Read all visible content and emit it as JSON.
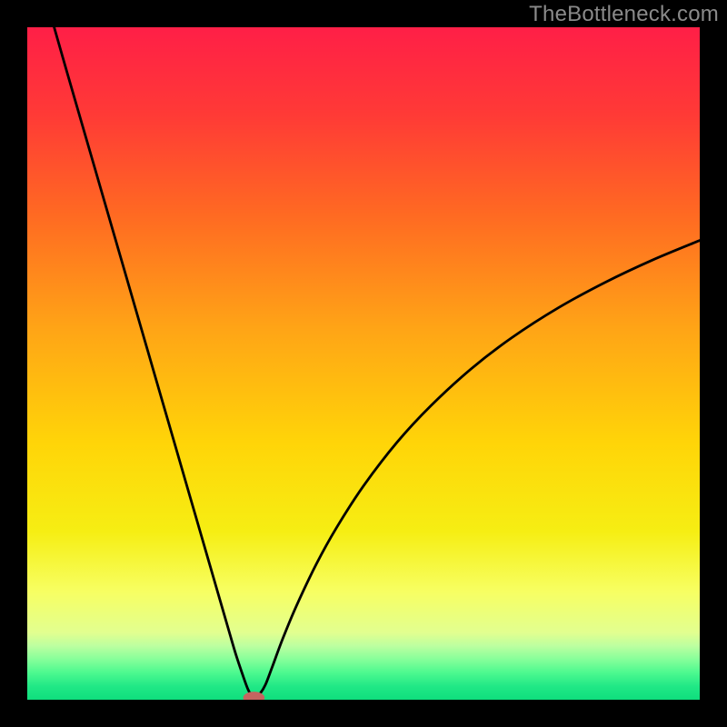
{
  "watermark": "TheBottleneck.com",
  "chart_data": {
    "type": "line",
    "title": "",
    "xlabel": "",
    "ylabel": "",
    "xlim": [
      0,
      100
    ],
    "ylim": [
      0,
      100
    ],
    "background_gradient_stops": [
      {
        "offset": 0.0,
        "color": "#ff1f47"
      },
      {
        "offset": 0.13,
        "color": "#ff3a36"
      },
      {
        "offset": 0.28,
        "color": "#ff6a22"
      },
      {
        "offset": 0.45,
        "color": "#ffa516"
      },
      {
        "offset": 0.62,
        "color": "#ffd508"
      },
      {
        "offset": 0.75,
        "color": "#f6ee13"
      },
      {
        "offset": 0.84,
        "color": "#f7ff63"
      },
      {
        "offset": 0.9,
        "color": "#e2ff8f"
      },
      {
        "offset": 0.92,
        "color": "#bcffa0"
      },
      {
        "offset": 0.94,
        "color": "#86ff9a"
      },
      {
        "offset": 0.96,
        "color": "#4cf98f"
      },
      {
        "offset": 0.98,
        "color": "#21e886"
      },
      {
        "offset": 1.0,
        "color": "#0fde7d"
      }
    ],
    "series": [
      {
        "name": "bottleneck-curve",
        "x": [
          4,
          6,
          8,
          10,
          12,
          14,
          16,
          18,
          20,
          22,
          24,
          26,
          28,
          30,
          31,
          32,
          32.8,
          33.4,
          34.0,
          34.6,
          35.4,
          36.4,
          38,
          40,
          43,
          46,
          50,
          55,
          60,
          66,
          72,
          79,
          86,
          93,
          100
        ],
        "y": [
          100,
          93,
          86.1,
          79.2,
          72.3,
          65.4,
          58.5,
          51.6,
          44.7,
          37.8,
          30.9,
          24.0,
          17.1,
          10.2,
          6.8,
          3.8,
          1.6,
          0.6,
          0.5,
          0.9,
          2.2,
          4.8,
          9.1,
          13.9,
          20.2,
          25.6,
          31.8,
          38.3,
          43.7,
          49.2,
          53.8,
          58.3,
          62.1,
          65.4,
          68.3
        ]
      }
    ],
    "marker": {
      "x": 33.7,
      "y": 0.3,
      "rx": 1.6,
      "ry": 0.9,
      "color": "#c56560"
    }
  }
}
